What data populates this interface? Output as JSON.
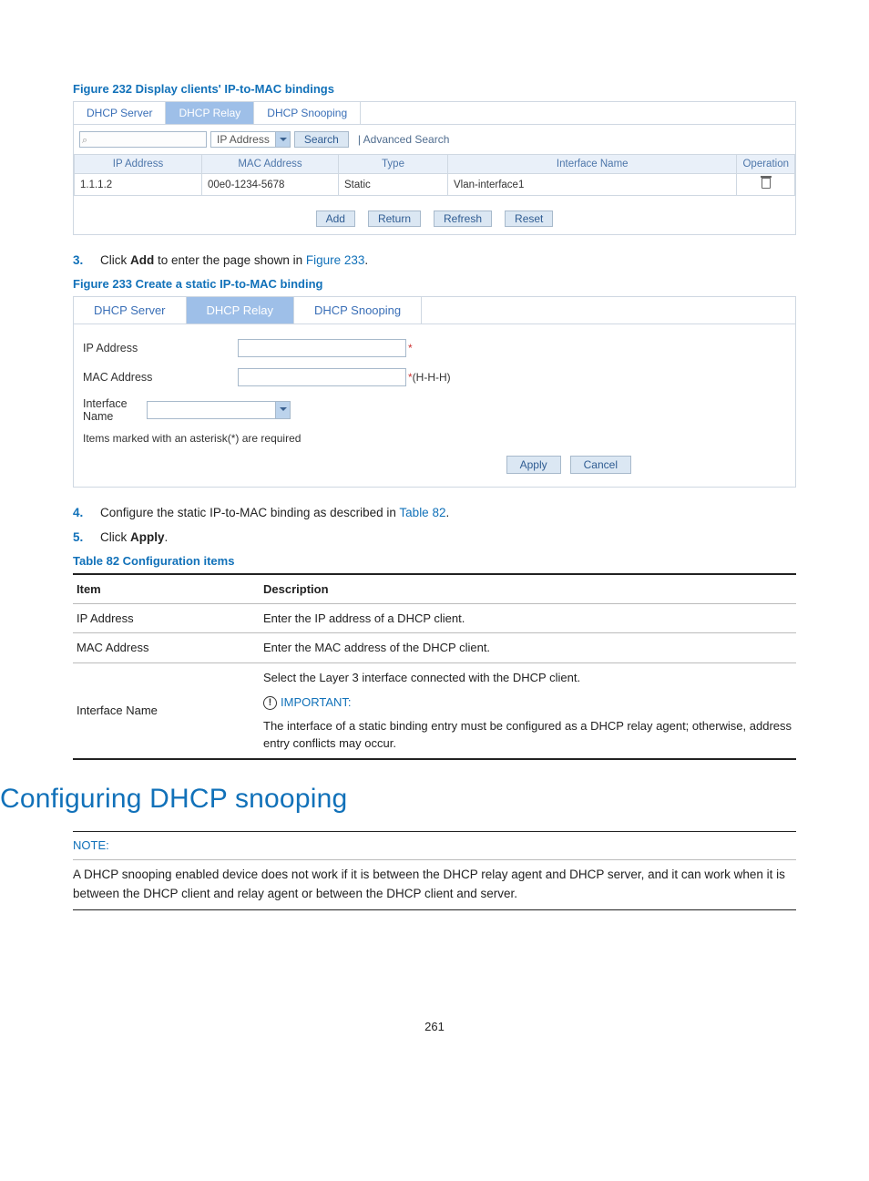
{
  "figure232": {
    "caption": "Figure 232 Display clients' IP-to-MAC bindings",
    "tabs": [
      "DHCP Server",
      "DHCP Relay",
      "DHCP Snooping"
    ],
    "active_tab": 1,
    "search_placeholder": "",
    "search_field_select": "IP Address",
    "search_button": "Search",
    "adv_search": "| Advanced Search",
    "columns": [
      "IP Address",
      "MAC Address",
      "Type",
      "Interface Name",
      "Operation"
    ],
    "rows": [
      {
        "ip": "1.1.1.2",
        "mac": "00e0-1234-5678",
        "type": "Static",
        "iface": "Vlan-interface1"
      }
    ],
    "actions": [
      "Add",
      "Return",
      "Refresh",
      "Reset"
    ]
  },
  "step3": {
    "num": "3.",
    "prefix": "Click ",
    "bold": "Add",
    "mid": " to enter the page shown in ",
    "link": "Figure 233",
    "suffix": "."
  },
  "figure233": {
    "caption": "Figure 233 Create a static IP-to-MAC binding",
    "tabs": [
      "DHCP Server",
      "DHCP Relay",
      "DHCP Snooping"
    ],
    "active_tab": 1,
    "fields": {
      "ip_label": "IP Address",
      "ip_hint": "*",
      "mac_label": "MAC Address",
      "mac_hint": "*(H-H-H)",
      "iface_label": "Interface Name"
    },
    "required_note": "Items marked with an asterisk(*) are required",
    "actions": [
      "Apply",
      "Cancel"
    ]
  },
  "step4": {
    "num": "4.",
    "prefix": "Configure the static IP-to-MAC binding as described in ",
    "link": "Table 82",
    "suffix": "."
  },
  "step5": {
    "num": "5.",
    "prefix": "Click ",
    "bold": "Apply",
    "suffix": "."
  },
  "table82": {
    "caption": "Table 82 Configuration items",
    "head_item": "Item",
    "head_desc": "Description",
    "rows": {
      "ip_item": "IP Address",
      "ip_desc": "Enter the IP address of a DHCP client.",
      "mac_item": "MAC Address",
      "mac_desc": "Enter the MAC address of the DHCP client.",
      "iface_item": "Interface Name",
      "iface_desc1": "Select the Layer 3 interface connected with the DHCP client.",
      "iface_important": "IMPORTANT:",
      "iface_desc2": "The interface of a static binding entry must be configured as a DHCP relay agent; otherwise, address entry conflicts may occur."
    }
  },
  "section_heading": "Configuring DHCP snooping",
  "note": {
    "head": "NOTE:",
    "body": "A DHCP snooping enabled device does not work if it is between the DHCP relay agent and DHCP server, and it can work when it is between the DHCP client and relay agent or between the DHCP client and server."
  },
  "page_number": "261"
}
